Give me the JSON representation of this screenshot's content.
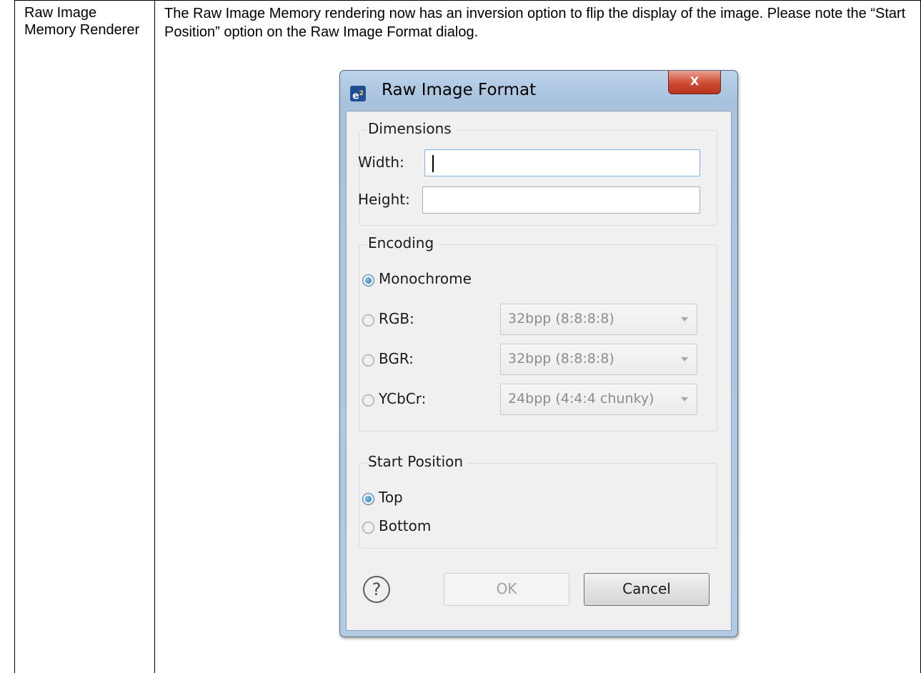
{
  "table": {
    "feature": "Raw Image Memory Renderer",
    "description": "The Raw Image Memory rendering now has an inversion option to flip the display of the image. Please note the “Start Position” option on the Raw Image Format dialog."
  },
  "dialog": {
    "title": "Raw Image Format",
    "app_icon": "e2-app-icon",
    "close_label": "X",
    "dimensions": {
      "group_label": "Dimensions",
      "width_label": "Width:",
      "width_value": "",
      "height_label": "Height:",
      "height_value": ""
    },
    "encoding": {
      "group_label": "Encoding",
      "options": [
        {
          "label": "Monochrome",
          "checked": true
        },
        {
          "label": "RGB:",
          "checked": false,
          "combo": "32bpp (8:8:8:8)"
        },
        {
          "label": "BGR:",
          "checked": false,
          "combo": "32bpp (8:8:8:8)"
        },
        {
          "label": "YCbCr:",
          "checked": false,
          "combo": "24bpp (4:4:4 chunky)"
        }
      ]
    },
    "start_position": {
      "group_label": "Start Position",
      "options": [
        {
          "label": "Top",
          "checked": true
        },
        {
          "label": "Bottom",
          "checked": false
        }
      ]
    },
    "help_icon": "question-mark-icon",
    "ok_label": "OK",
    "cancel_label": "Cancel"
  }
}
